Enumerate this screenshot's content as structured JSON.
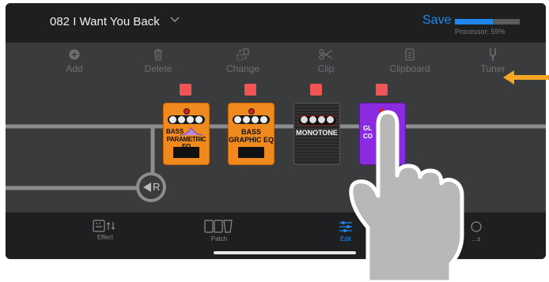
{
  "header": {
    "preset_name": "082 I Want You Back",
    "save_label": "Save",
    "processor_label": "Processor: 59%",
    "processor_fraction": 0.59
  },
  "toolbar": {
    "items": [
      {
        "label": "Add",
        "icon": "plus-circle-icon"
      },
      {
        "label": "Delete",
        "icon": "trash-icon"
      },
      {
        "label": "Change",
        "icon": "change-icon"
      },
      {
        "label": "Clip",
        "icon": "scissors-icon"
      },
      {
        "label": "Clipboard",
        "icon": "clipboard-icon"
      },
      {
        "label": "Tuner",
        "icon": "tuning-fork-icon"
      }
    ]
  },
  "pedals": [
    {
      "name": "BASS PARAMETRIC EQ",
      "line1": "BASS",
      "line2": "PARAMETRIC EQ",
      "color": "#f08a1e"
    },
    {
      "name": "BASS GRAPHIC EQ",
      "line1": "BASS",
      "line2": "GRAPHIC EQ",
      "color": "#f08a1e"
    },
    {
      "name": "MONOTONE",
      "line1": "MONOTONE",
      "color": "#2a2a2a"
    },
    {
      "name": "GL... CO...",
      "line1": "GL",
      "line2": "CO",
      "color": "#8a2be2"
    }
  ],
  "return_label": "R",
  "bottom_nav": {
    "items": [
      {
        "label": "Effect",
        "icon": "effect-icon"
      },
      {
        "label": "Patch",
        "icon": "patch-icon"
      },
      {
        "label": "Edit",
        "icon": "edit-sliders-icon",
        "active": true
      },
      {
        "label": "...s",
        "icon": "settings-icon"
      }
    ]
  },
  "colors": {
    "accent": "#1e88f0",
    "selected_marker": "#f05454",
    "annotation_arrow": "#f5a623"
  }
}
